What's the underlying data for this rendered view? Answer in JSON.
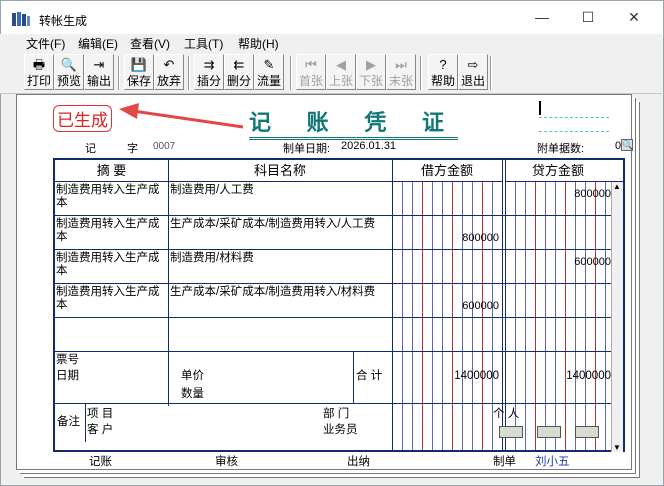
{
  "window": {
    "title": "转帐生成",
    "controls": {
      "minimize": "—",
      "maximize": "☐",
      "close": "✕"
    }
  },
  "menu": [
    "文件(F)",
    "编辑(E)",
    "查看(V)",
    "工具(T)",
    "帮助(H)"
  ],
  "toolbar": [
    {
      "label": "打印",
      "icon": "printer-icon",
      "enabled": true
    },
    {
      "label": "预览",
      "icon": "preview-icon",
      "enabled": true
    },
    {
      "label": "输出",
      "icon": "export-icon",
      "enabled": true
    },
    {
      "label": "保存",
      "icon": "save-icon",
      "enabled": true
    },
    {
      "label": "放弃",
      "icon": "undo-icon",
      "enabled": true
    },
    {
      "label": "插分",
      "icon": "insert-row-icon",
      "enabled": true
    },
    {
      "label": "删分",
      "icon": "delete-row-icon",
      "enabled": true
    },
    {
      "label": "流量",
      "icon": "cashflow-icon",
      "enabled": true
    },
    {
      "label": "首张",
      "icon": "first-icon",
      "enabled": false
    },
    {
      "label": "上张",
      "icon": "prev-icon",
      "enabled": false
    },
    {
      "label": "下张",
      "icon": "next-icon",
      "enabled": false
    },
    {
      "label": "末张",
      "icon": "last-icon",
      "enabled": false
    },
    {
      "label": "帮助",
      "icon": "help-icon",
      "enabled": true
    },
    {
      "label": "退出",
      "icon": "exit-icon",
      "enabled": true
    }
  ],
  "voucher": {
    "stamp": "已生成",
    "title": "记 账 凭 证",
    "type_label": "记",
    "no_label": "字",
    "no": "0007",
    "date_label": "制单日期:",
    "date": "2026.01.31",
    "attach_label": "附单据数:",
    "attach": "0",
    "headers": {
      "summary": "摘 要",
      "account": "科目名称",
      "debit": "借方金额",
      "credit": "贷方金额"
    },
    "rows": [
      {
        "summary": "制造费用转入生产成本",
        "account": "制造费用/人工费",
        "debit": "",
        "credit": "800000"
      },
      {
        "summary": "制造费用转入生产成本",
        "account": "生产成本/采矿成本/制造费用转入/人工费",
        "debit": "800000",
        "credit": ""
      },
      {
        "summary": "制造费用转入生产成本",
        "account": "制造费用/材料费",
        "debit": "",
        "credit": "600000"
      },
      {
        "summary": "制造费用转入生产成本",
        "account": "生产成本/采矿成本/制造费用转入/材料费",
        "debit": "600000",
        "credit": ""
      }
    ],
    "ticket_no_label": "票号",
    "ticket_date_label": "日期",
    "price_label": "单价",
    "qty_label": "数量",
    "total_label": "合 计",
    "total_debit": "1400000",
    "total_credit": "1400000",
    "remark_label": "备注",
    "project_label": "项 目",
    "customer_label": "客 户",
    "dept_label": "部 门",
    "staff_label": "业务员",
    "person_label": "个 人",
    "footer": {
      "bookkeeper": "记账",
      "audit": "审核",
      "cashier": "出纳",
      "maker_label": "制单",
      "maker": "刘小五"
    }
  }
}
